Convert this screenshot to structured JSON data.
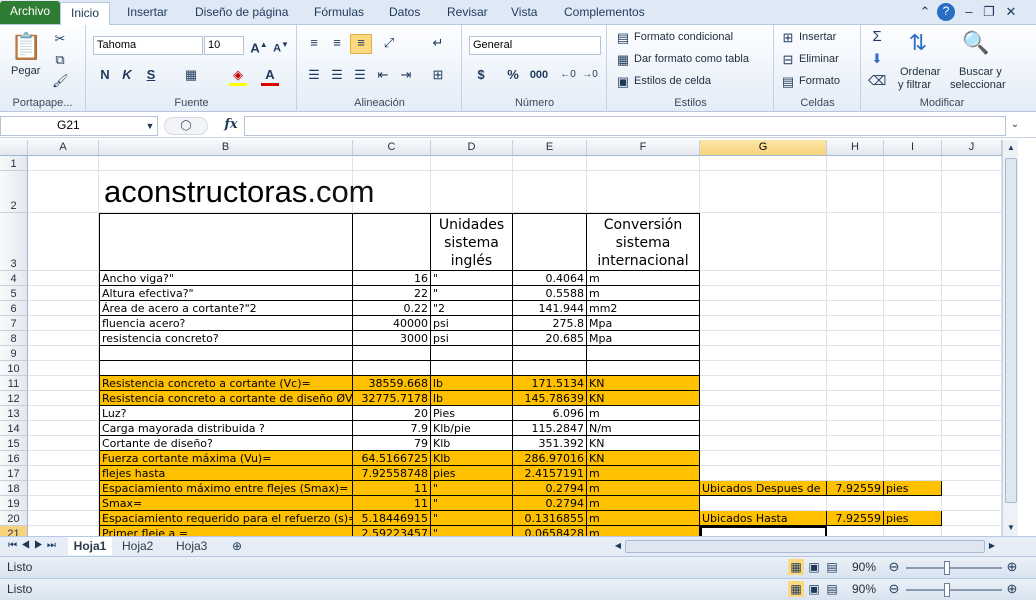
{
  "tabs": [
    "Archivo",
    "Inicio",
    "Insertar",
    "Diseño de página",
    "Fórmulas",
    "Datos",
    "Revisar",
    "Vista",
    "Complementos"
  ],
  "ribbon": {
    "pegar": "Pegar",
    "portapapeles": "Portapape...",
    "font_name": "Tahoma",
    "font_size": "10",
    "fuente": "Fuente",
    "alineacion": "Alineación",
    "number_format": "General",
    "numero": "Número",
    "formato_condicional": "Formato condicional",
    "dar_formato": "Dar formato como tabla",
    "estilos_celda": "Estilos de celda",
    "estilos": "Estilos",
    "insertar": "Insertar",
    "eliminar": "Eliminar",
    "formato": "Formato",
    "celdas": "Celdas",
    "ordenar_1": "Ordenar",
    "ordenar_2": "y filtrar",
    "buscar_1": "Buscar y",
    "buscar_2": "seleccionar",
    "modificar": "Modificar",
    "bold": "N",
    "italic": "K",
    "underline": "S",
    "percent": "%",
    "thousands": "000",
    "currency": "$",
    "fx": "fx"
  },
  "formula_bar": {
    "name_box": "G21",
    "formula": ""
  },
  "columns": [
    "A",
    "B",
    "C",
    "D",
    "E",
    "F",
    "G",
    "H",
    "I",
    "J"
  ],
  "rows": [
    "1",
    "2",
    "3",
    "4",
    "5",
    "6",
    "7",
    "8",
    "9",
    "10",
    "11",
    "12",
    "13",
    "14",
    "15",
    "16",
    "17",
    "18",
    "19",
    "20",
    "21"
  ],
  "sheet": {
    "logo": "aconstructoras.com",
    "header_d": [
      "Unidades",
      "sistema",
      "inglés"
    ],
    "header_f": [
      "Conversión",
      "sistema",
      "internacional"
    ],
    "data": [
      {
        "b": "Ancho viga?\"",
        "c": "16",
        "d": "\"",
        "e": "0.4064",
        "f": "m"
      },
      {
        "b": "Altura efectiva?\"",
        "c": "22",
        "d": "\"",
        "e": "0.5588",
        "f": "m"
      },
      {
        "b": "Área de acero a cortante?\"2",
        "c": "0.22",
        "d": "\"2",
        "e": "141.944",
        "f": "mm2"
      },
      {
        "b": "fluencia acero?",
        "c": "40000",
        "d": "psi",
        "e": "275.8",
        "f": "Mpa"
      },
      {
        "b": "resistencia concreto?",
        "c": "3000",
        "d": "psi",
        "e": "20.685",
        "f": "Mpa"
      },
      {
        "b": "",
        "c": "",
        "d": "",
        "e": "",
        "f": ""
      },
      {
        "b": "",
        "c": "",
        "d": "",
        "e": "",
        "f": ""
      },
      {
        "b": "Resistencia concreto a cortante (Vc)=",
        "c": "38559.668",
        "d": "lb",
        "e": "171.5134",
        "f": "KN"
      },
      {
        "b": "Resistencia concreto  a cortante de diseño ØVc",
        "c": "32775.7178",
        "d": "lb",
        "e": "145.78639",
        "f": "KN"
      },
      {
        "b": "Luz?",
        "c": "20",
        "d": "Pies",
        "e": "6.096",
        "f": "m"
      },
      {
        "b": "Carga mayorada distribuida ?",
        "c": "7.9",
        "d": "Klb/pie",
        "e": "115.2847",
        "f": "N/m"
      },
      {
        "b": "Cortante de diseño?",
        "c": "79",
        "d": "Klb",
        "e": "351.392",
        "f": "KN"
      },
      {
        "b": "Fuerza cortante máxima (Vu)=",
        "c": "64.5166725",
        "d": "Klb",
        "e": "286.97016",
        "f": "KN"
      },
      {
        "b": "flejes hasta",
        "c": "7.92558748",
        "d": "pies",
        "e": "2.4157191",
        "f": "m"
      },
      {
        "b": "Espaciamiento máximo entre flejes (Smax)=",
        "c": "11",
        "d": "\"",
        "e": "0.2794",
        "f": "m"
      },
      {
        "b": "Smax=",
        "c": "11",
        "d": "\"",
        "e": "0.2794",
        "f": "m"
      },
      {
        "b": "Espaciamiento requerido para el refuerzo (s)=",
        "c": "5.18446915",
        "d": "\"",
        "e": "0.1316855",
        "f": "m"
      },
      {
        "b": "Primer fleje a  =",
        "c": "2.59223457",
        "d": "\"",
        "e": "0.0658428",
        "f": "m"
      }
    ],
    "g18": "Ubicados Despues de",
    "h18": "7.92559",
    "i18": "pies",
    "g20": "Ubicados Hasta",
    "h20": "7.92559",
    "i20": "pies"
  },
  "sheet_tabs": [
    "Hoja1",
    "Hoja2",
    "Hoja3"
  ],
  "status": {
    "text1": "Listo",
    "text2": "Listo",
    "zoom": "90%"
  },
  "colors": {
    "orange": "#ffc000",
    "ribbon_bg": "#dfe9f5",
    "file_tab": "#2f7d32"
  }
}
